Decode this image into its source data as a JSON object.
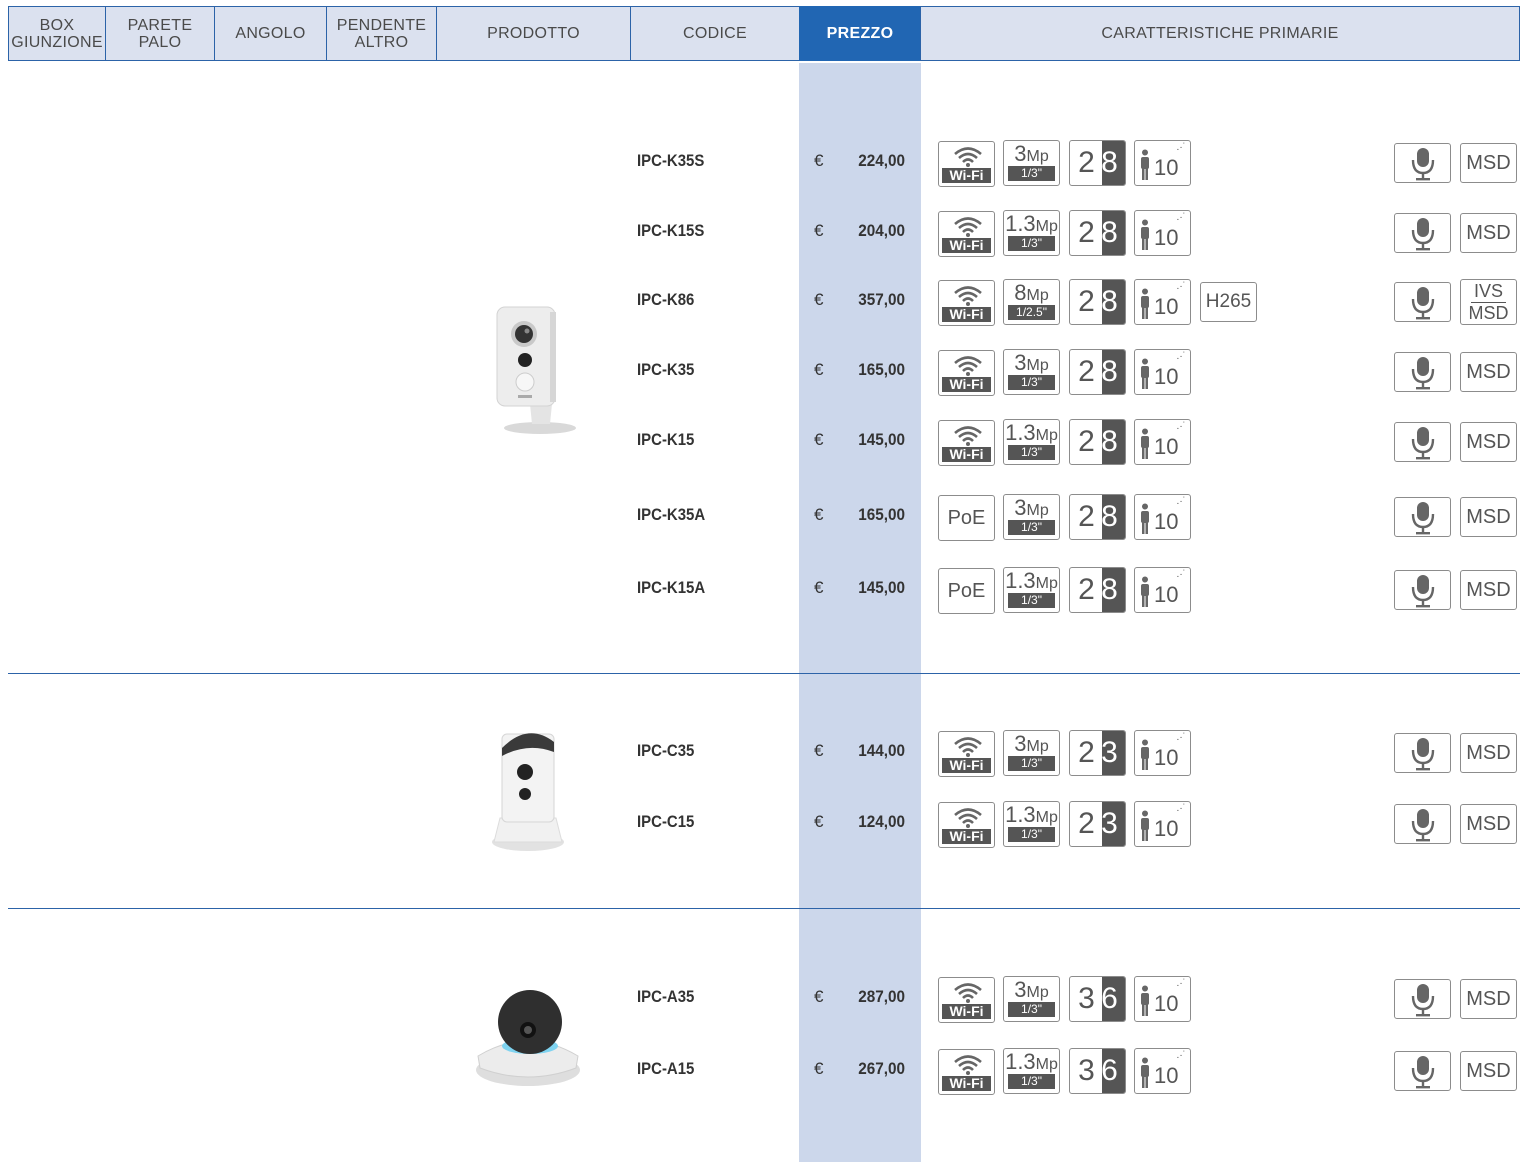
{
  "header": {
    "box": "BOX\nGIUNZIONE",
    "parete": "PARETE\nPALO",
    "angolo": "ANGOLO",
    "pendente": "PENDENTE\nALTRO",
    "prodotto": "PRODOTTO",
    "codice": "CODICE",
    "prezzo": "PREZZO",
    "caratteristiche": "CARATTERISTICHE PRIMARIE"
  },
  "currency": "€",
  "icon_labels": {
    "wifi": "Wi-Fi",
    "poe": "PoE",
    "mp_unit": "Mp",
    "h265": "H265",
    "ivs": "IVS",
    "msd": "MSD",
    "ir_distance": "10"
  },
  "rows": [
    {
      "code": "IPC-K35S",
      "price": "224,00",
      "conn": "wifi",
      "mp": "3",
      "sensor": "1/3\"",
      "lens_a": "2",
      "lens_b": ".8",
      "h265": false,
      "ivs": false
    },
    {
      "code": "IPC-K15S",
      "price": "204,00",
      "conn": "wifi",
      "mp": "1.3",
      "sensor": "1/3\"",
      "lens_a": "2",
      "lens_b": ".8",
      "h265": false,
      "ivs": false
    },
    {
      "code": "IPC-K86",
      "price": "357,00",
      "conn": "wifi",
      "mp": "8",
      "sensor": "1/2.5\"",
      "lens_a": "2",
      "lens_b": ".8",
      "h265": true,
      "ivs": true
    },
    {
      "code": "IPC-K35",
      "price": "165,00",
      "conn": "wifi",
      "mp": "3",
      "sensor": "1/3\"",
      "lens_a": "2",
      "lens_b": ".8",
      "h265": false,
      "ivs": false
    },
    {
      "code": "IPC-K15",
      "price": "145,00",
      "conn": "wifi",
      "mp": "1.3",
      "sensor": "1/3\"",
      "lens_a": "2",
      "lens_b": ".8",
      "h265": false,
      "ivs": false
    },
    {
      "code": "IPC-K35A",
      "price": "165,00",
      "conn": "poe",
      "mp": "3",
      "sensor": "1/3\"",
      "lens_a": "2",
      "lens_b": ".8",
      "h265": false,
      "ivs": false
    },
    {
      "code": "IPC-K15A",
      "price": "145,00",
      "conn": "poe",
      "mp": "1.3",
      "sensor": "1/3\"",
      "lens_a": "2",
      "lens_b": ".8",
      "h265": false,
      "ivs": false
    },
    {
      "code": "IPC-C35",
      "price": "144,00",
      "conn": "wifi",
      "mp": "3",
      "sensor": "1/3\"",
      "lens_a": "2",
      "lens_b": ".3",
      "h265": false,
      "ivs": false
    },
    {
      "code": "IPC-C15",
      "price": "124,00",
      "conn": "wifi",
      "mp": "1.3",
      "sensor": "1/3\"",
      "lens_a": "2",
      "lens_b": ".3",
      "h265": false,
      "ivs": false
    },
    {
      "code": "IPC-A35",
      "price": "287,00",
      "conn": "wifi",
      "mp": "3",
      "sensor": "1/3\"",
      "lens_a": "3",
      "lens_b": ".6",
      "h265": false,
      "ivs": false
    },
    {
      "code": "IPC-A15",
      "price": "267,00",
      "conn": "wifi",
      "mp": "1.3",
      "sensor": "1/3\"",
      "lens_a": "3",
      "lens_b": ".6",
      "h265": false,
      "ivs": false
    }
  ],
  "products": [
    {
      "name": "cube-camera-k-series-image"
    },
    {
      "name": "cube-camera-c-series-image"
    },
    {
      "name": "pan-tilt-camera-a-series-image"
    }
  ]
}
